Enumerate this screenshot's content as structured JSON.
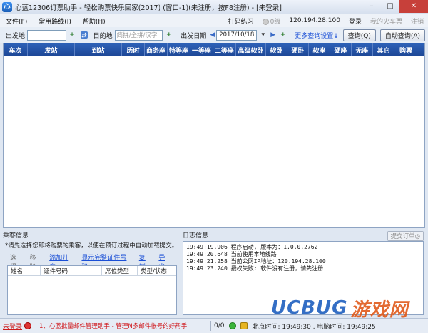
{
  "window": {
    "icon_text": "心",
    "title": "心蓝12306订票助手 - 轻松购票快乐回家(2017) (窗口-1)(未注册，按F8注册) - [未登录]",
    "minimize": "–",
    "maximize": "□",
    "close": "✕"
  },
  "menu": {
    "items": [
      "文件(F)",
      "常用路线(I)",
      "帮助(H)"
    ],
    "practice": "打码练习",
    "level": "0级",
    "ip": "120.194.28.100",
    "login": "登录",
    "my_train": "我的火车票",
    "logout": "注销"
  },
  "toolbar": {
    "from_label": "出发地",
    "from_value": "",
    "to_label": "目的地",
    "to_placeholder": "简拼/全拼/汉字",
    "date_label": "出发日期",
    "date_value": "2017/10/18",
    "more_settings": "更多查询设置↓",
    "query_btn": "查询(Q)",
    "auto_query_btn": "自动查询(A)"
  },
  "table": {
    "columns": [
      "车次",
      "发站",
      "到站",
      "历时",
      "商务座",
      "特等座",
      "一等座",
      "二等座",
      "高级软卧",
      "软卧",
      "硬卧",
      "软座",
      "硬座",
      "无座",
      "其它",
      "购票"
    ]
  },
  "passenger": {
    "title": "乘客信息",
    "hint": "*请先选择您即将购票的乘客，以便在预订过程中自动加载提交。",
    "actions": {
      "select": "选择",
      "remove": "移除",
      "add_child": "添加儿童",
      "show_id": "显示完整证件号码",
      "copy": "复制",
      "export": "导出"
    },
    "columns": [
      "姓名",
      "证件号码",
      "席位类型",
      "类型/状态"
    ]
  },
  "log": {
    "title": "日志信息",
    "submit_btn": "提交订单◎",
    "lines": [
      "19:49:19.906  程序启动, 版本为：1.0.0.2762",
      "19:49:20.648  当前使用本地线路",
      "19:49:21.258  当前公网IP地址：120.194.28.100",
      "19:49:23.240  授权失败:  软件没有注册，请先注册"
    ]
  },
  "status": {
    "not_logged_in": "未登录",
    "marquee": "1、心蓝批量邮件管理助手 - 管理N多邮件帐号的好帮手",
    "count": "0/0",
    "beijing_time": "北京时间: 19:49:30 , 电脑时间: 19:49:25"
  },
  "watermark": {
    "part1": "UCBUG",
    "part2": "游戏网"
  },
  "colors": {
    "header_blue": "#1d4796",
    "link_blue": "#1a4fd6",
    "alert_red": "#d0181c"
  }
}
